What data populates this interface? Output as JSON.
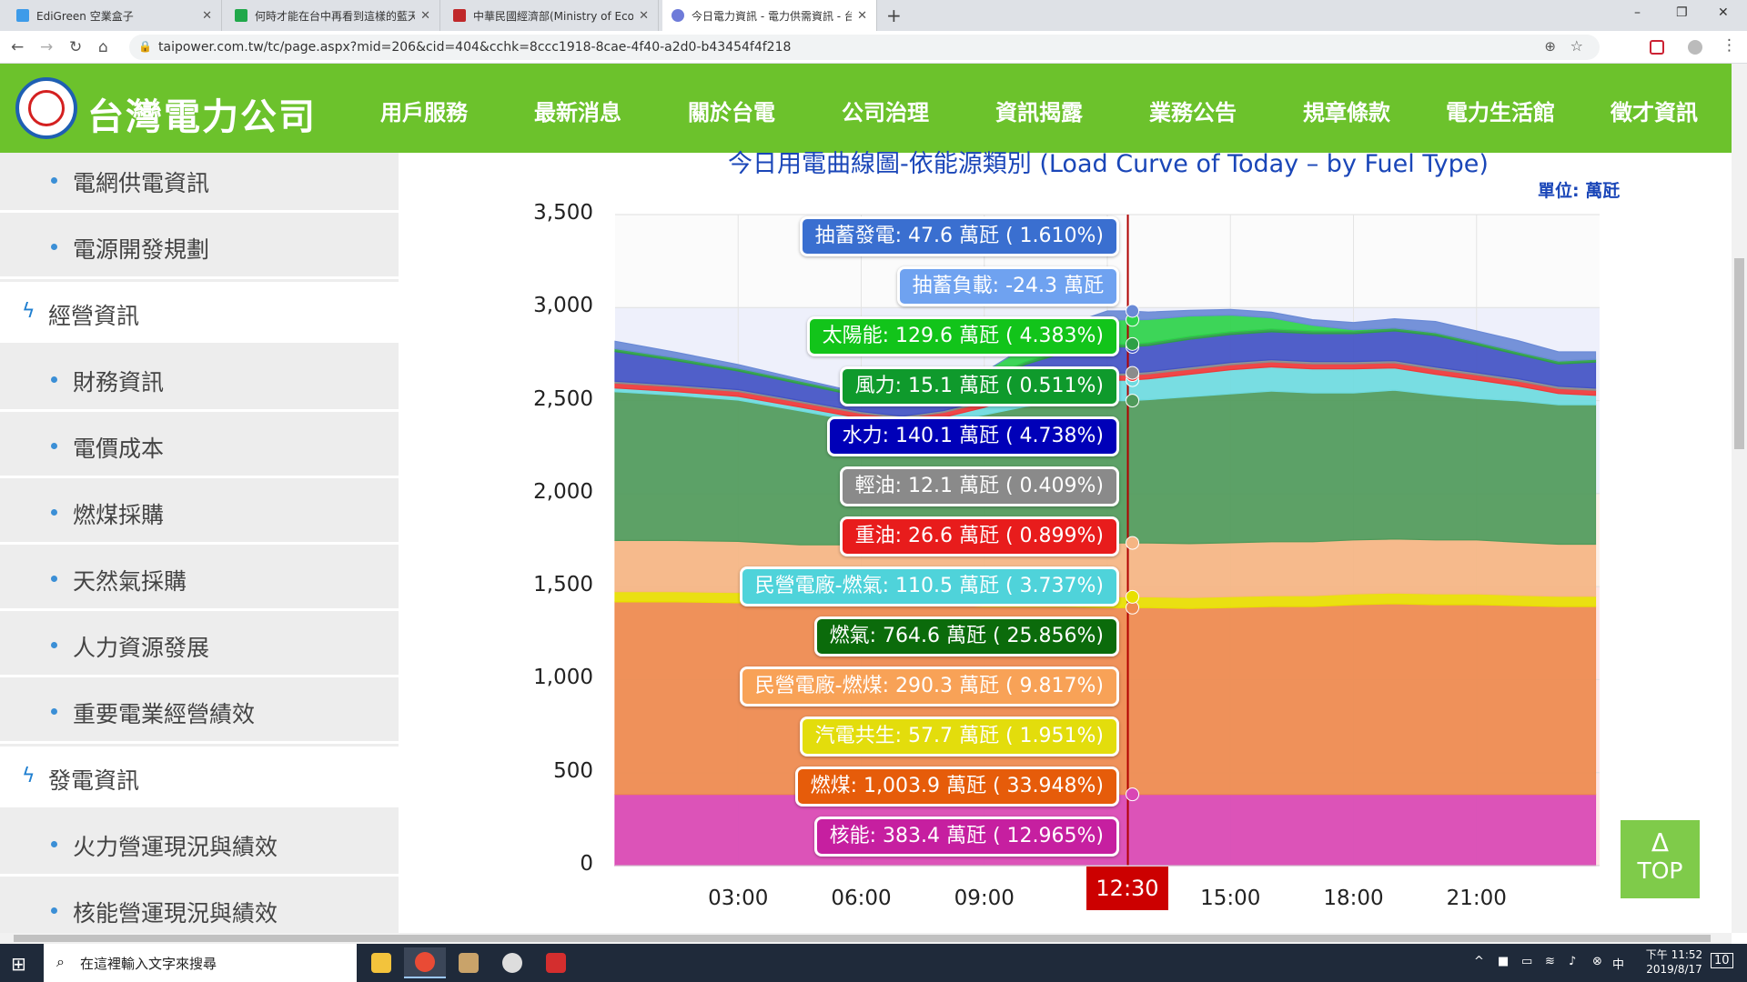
{
  "browser": {
    "tabs": [
      {
        "title": "EdiGreen 空業盒子",
        "favicon_color": "#3d9be9",
        "active": false
      },
      {
        "title": "何時才能在台中再看到這樣的藍天",
        "favicon_color": "#20a84a",
        "active": false
      },
      {
        "title": "中華民國經濟部(Ministry of Eco...",
        "favicon_color": "#c0282a",
        "active": false
      },
      {
        "title": "今日電力資訊 - 電力供需資訊 - 台",
        "favicon_color": "#6e7bd9",
        "active": true
      }
    ],
    "new_tab": "+",
    "url": "taipower.com.tw/tc/page.aspx?mid=206&cid=404&cchk=8ccc1918-8cae-4f40-a2d0-b43454f4f218",
    "window_controls": {
      "minimize": "–",
      "restore": "❐",
      "close": "✕"
    }
  },
  "site": {
    "logo_text": "台灣電力公司",
    "menu": [
      "用戶服務",
      "最新消息",
      "關於台電",
      "公司治理",
      "資訊揭露",
      "業務公告",
      "規章條款",
      "電力生活館",
      "徵才資訊"
    ]
  },
  "sidebar": [
    {
      "label": "電網供電資訊",
      "type": "item"
    },
    {
      "label": "電源開發規劃",
      "type": "item"
    },
    {
      "label": "經營資訊",
      "type": "section"
    },
    {
      "label": "財務資訊",
      "type": "item"
    },
    {
      "label": "電價成本",
      "type": "item"
    },
    {
      "label": "燃煤採購",
      "type": "item"
    },
    {
      "label": "天然氣採購",
      "type": "item"
    },
    {
      "label": "人力資源發展",
      "type": "item"
    },
    {
      "label": "重要電業經營績效",
      "type": "item"
    },
    {
      "label": "發電資訊",
      "type": "section"
    },
    {
      "label": "火力營運現況與績效",
      "type": "item"
    },
    {
      "label": "核能營運現況與績效",
      "type": "item"
    }
  ],
  "chart_data": {
    "type": "area",
    "title": "今日用電曲線圖-依能源類別 (Load Curve of Today – by Fuel Type)",
    "unit": "單位: 萬瓩",
    "ylim": [
      0,
      3500
    ],
    "yticks": [
      "0",
      "500",
      "1,000",
      "1,500",
      "2,000",
      "2,500",
      "3,000",
      "3,500"
    ],
    "xticks": [
      "03:00",
      "06:00",
      "09:00",
      "15:00",
      "18:00",
      "21:00"
    ],
    "cursor_time": "12:30",
    "stack_order_bottom_to_top": [
      "核能",
      "燃煤",
      "汽電共生",
      "民營電廠-燃煤",
      "燃氣",
      "民營電廠-燃氣",
      "重油",
      "輕油",
      "水力",
      "風力",
      "太陽能",
      "抽蓄發電"
    ],
    "x_hours": [
      0,
      1.5,
      3,
      4.5,
      6,
      7,
      8,
      9,
      10,
      11,
      12,
      12.5,
      13,
      14,
      15,
      16,
      17,
      18,
      19,
      20,
      21,
      22,
      23,
      23.9
    ],
    "series": [
      {
        "name": "核能",
        "color": "#d946b4",
        "values": [
          383,
          383,
          383,
          383,
          383,
          383,
          383,
          383,
          383,
          383,
          383,
          383,
          383,
          383,
          383,
          383,
          383,
          383,
          383,
          383,
          383,
          383,
          383,
          383
        ]
      },
      {
        "name": "燃煤",
        "color": "#ee8a4e",
        "values": [
          1035,
          1035,
          1030,
          1025,
          1025,
          1020,
          1020,
          1010,
          1010,
          1010,
          1004,
          1004,
          1004,
          1000,
          1005,
          1010,
          1010,
          1020,
          1025,
          1020,
          1020,
          1015,
          1010,
          1010
        ]
      },
      {
        "name": "汽電共生",
        "color": "#e8e000",
        "values": [
          55,
          55,
          55,
          52,
          52,
          52,
          52,
          55,
          55,
          55,
          58,
          58,
          58,
          58,
          58,
          58,
          58,
          58,
          58,
          58,
          58,
          56,
          55,
          55
        ]
      },
      {
        "name": "民營電廠-燃煤",
        "color": "#f5b583",
        "values": [
          275,
          275,
          275,
          265,
          265,
          265,
          270,
          275,
          280,
          285,
          290,
          290,
          290,
          290,
          290,
          290,
          290,
          290,
          290,
          290,
          290,
          285,
          280,
          280
        ]
      },
      {
        "name": "燃氣",
        "color": "#4f9a5a",
        "values": [
          800,
          780,
          760,
          720,
          660,
          640,
          660,
          700,
          740,
          760,
          765,
          765,
          770,
          790,
          800,
          810,
          800,
          790,
          800,
          780,
          760,
          760,
          750,
          750
        ]
      },
      {
        "name": "民營電廠-燃氣",
        "color": "#6edbe0",
        "values": [
          20,
          20,
          20,
          20,
          20,
          20,
          25,
          40,
          70,
          100,
          110,
          110,
          112,
          120,
          130,
          130,
          130,
          130,
          120,
          110,
          100,
          80,
          60,
          50
        ]
      },
      {
        "name": "重油",
        "color": "#ef3838",
        "values": [
          26,
          26,
          26,
          26,
          26,
          26,
          26,
          26,
          26,
          26,
          27,
          27,
          27,
          27,
          27,
          27,
          27,
          27,
          27,
          27,
          27,
          27,
          27,
          27
        ]
      },
      {
        "name": "輕油",
        "color": "#8c8c8c",
        "values": [
          10,
          10,
          10,
          10,
          10,
          10,
          10,
          10,
          10,
          12,
          12,
          12,
          12,
          12,
          12,
          12,
          12,
          12,
          12,
          12,
          12,
          12,
          12,
          12
        ]
      },
      {
        "name": "水力",
        "color": "#4252c4",
        "values": [
          160,
          130,
          100,
          90,
          80,
          80,
          80,
          100,
          120,
          130,
          140,
          140,
          140,
          150,
          150,
          150,
          150,
          150,
          160,
          170,
          150,
          130,
          120,
          140
        ]
      },
      {
        "name": "風力",
        "color": "#2da046",
        "values": [
          15,
          15,
          15,
          15,
          15,
          15,
          15,
          15,
          15,
          15,
          15,
          15,
          15,
          15,
          15,
          15,
          15,
          15,
          15,
          15,
          15,
          15,
          15,
          15
        ]
      },
      {
        "name": "太陽能",
        "color": "#2ed34a",
        "values": [
          0,
          0,
          0,
          0,
          0,
          0,
          10,
          40,
          80,
          110,
          130,
          130,
          125,
          110,
          90,
          60,
          30,
          5,
          0,
          0,
          0,
          0,
          0,
          0
        ]
      },
      {
        "name": "抽蓄發電",
        "color": "#6a8ad6",
        "values": [
          40,
          30,
          20,
          10,
          5,
          0,
          0,
          0,
          0,
          20,
          48,
          48,
          40,
          30,
          30,
          30,
          30,
          40,
          50,
          60,
          60,
          60,
          50,
          40
        ]
      }
    ],
    "tooltip": [
      {
        "text": "抽蓄發電: 47.6 萬瓩 ( 1.610%)",
        "color": "#3a6fd0"
      },
      {
        "text": "抽蓄負載: -24.3 萬瓩",
        "color": "#6fa2f0"
      },
      {
        "text": "太陽能: 129.6 萬瓩 ( 4.383%)",
        "color": "#12c41a"
      },
      {
        "text": "風力: 15.1 萬瓩 ( 0.511%)",
        "color": "#0f9a2c"
      },
      {
        "text": "水力: 140.1 萬瓩 ( 4.738%)",
        "color": "#0000b8"
      },
      {
        "text": "輕油: 12.1 萬瓩 ( 0.409%)",
        "color": "#8a8a8a"
      },
      {
        "text": "重油: 26.6 萬瓩 ( 0.899%)",
        "color": "#e81c1c"
      },
      {
        "text": "民營電廠-燃氣: 110.5 萬瓩 ( 3.737%)",
        "color": "#4fd3da"
      },
      {
        "text": "燃氣: 764.6 萬瓩 ( 25.856%)",
        "color": "#0b6b0b"
      },
      {
        "text": "民營電廠-燃煤: 290.3 萬瓩 ( 9.817%)",
        "color": "#f8a257"
      },
      {
        "text": "汽電共生: 57.7 萬瓩 ( 1.951%)",
        "color": "#e3dd0c"
      },
      {
        "text": "燃煤: 1,003.9 萬瓩 ( 33.948%)",
        "color": "#e65c0a"
      },
      {
        "text": "核能: 383.4 萬瓩 ( 12.965%)",
        "color": "#c61fa0"
      }
    ]
  },
  "top_button": {
    "arrow": "Δ",
    "label": "TOP"
  },
  "taskbar": {
    "search_placeholder": "在這裡輸入文字來搜尋",
    "time": "下午 11:52",
    "date": "2019/8/17",
    "notifications": "10"
  }
}
